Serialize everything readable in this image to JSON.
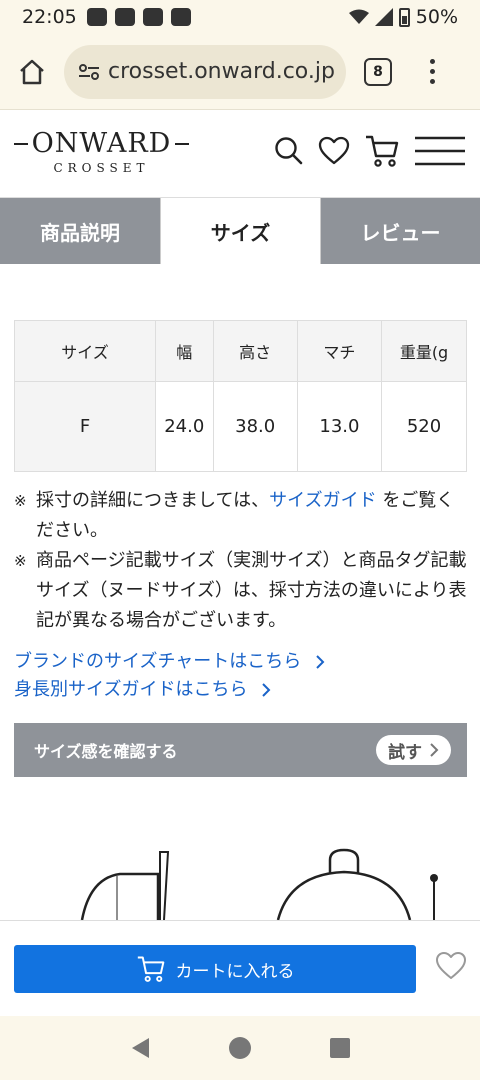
{
  "status_bar": {
    "time": "22:05",
    "battery": "50%"
  },
  "browser": {
    "url": "crosset.onward.co.jp",
    "tab_count": "8"
  },
  "logo": {
    "main": "ONWARD",
    "sub": "CROSSET"
  },
  "tabs": [
    {
      "label": "商品説明",
      "active": false
    },
    {
      "label": "サイズ",
      "active": true
    },
    {
      "label": "レビュー",
      "active": false
    }
  ],
  "size_table": {
    "headers": [
      "サイズ",
      "幅",
      "高さ",
      "マチ",
      "重量(g"
    ],
    "rows": [
      [
        "F",
        "24.0",
        "38.0",
        "13.0",
        "520"
      ]
    ]
  },
  "notes": {
    "mark": "※",
    "note1_before": "採寸の詳細につきましては、",
    "note1_link": "サイズガイド",
    "note1_after": "をご覧ください。",
    "note2": "商品ページ記載サイズ（実測サイズ）と商品タグ記載サイズ（ヌードサイズ）は、採寸方法の違いにより表記が異なる場合がございます。"
  },
  "links": {
    "brand_size_chart": "ブランドのサイズチャートはこちら",
    "height_size_guide": "身長別サイズガイドはこちら"
  },
  "size_feel": {
    "label": "サイズ感を確認する",
    "button": "試す"
  },
  "cart": {
    "button": "カートに入れる"
  },
  "colors": {
    "accent_blue": "#1273e0",
    "link_blue": "#1a63c8",
    "tab_gray": "#8f9399"
  }
}
